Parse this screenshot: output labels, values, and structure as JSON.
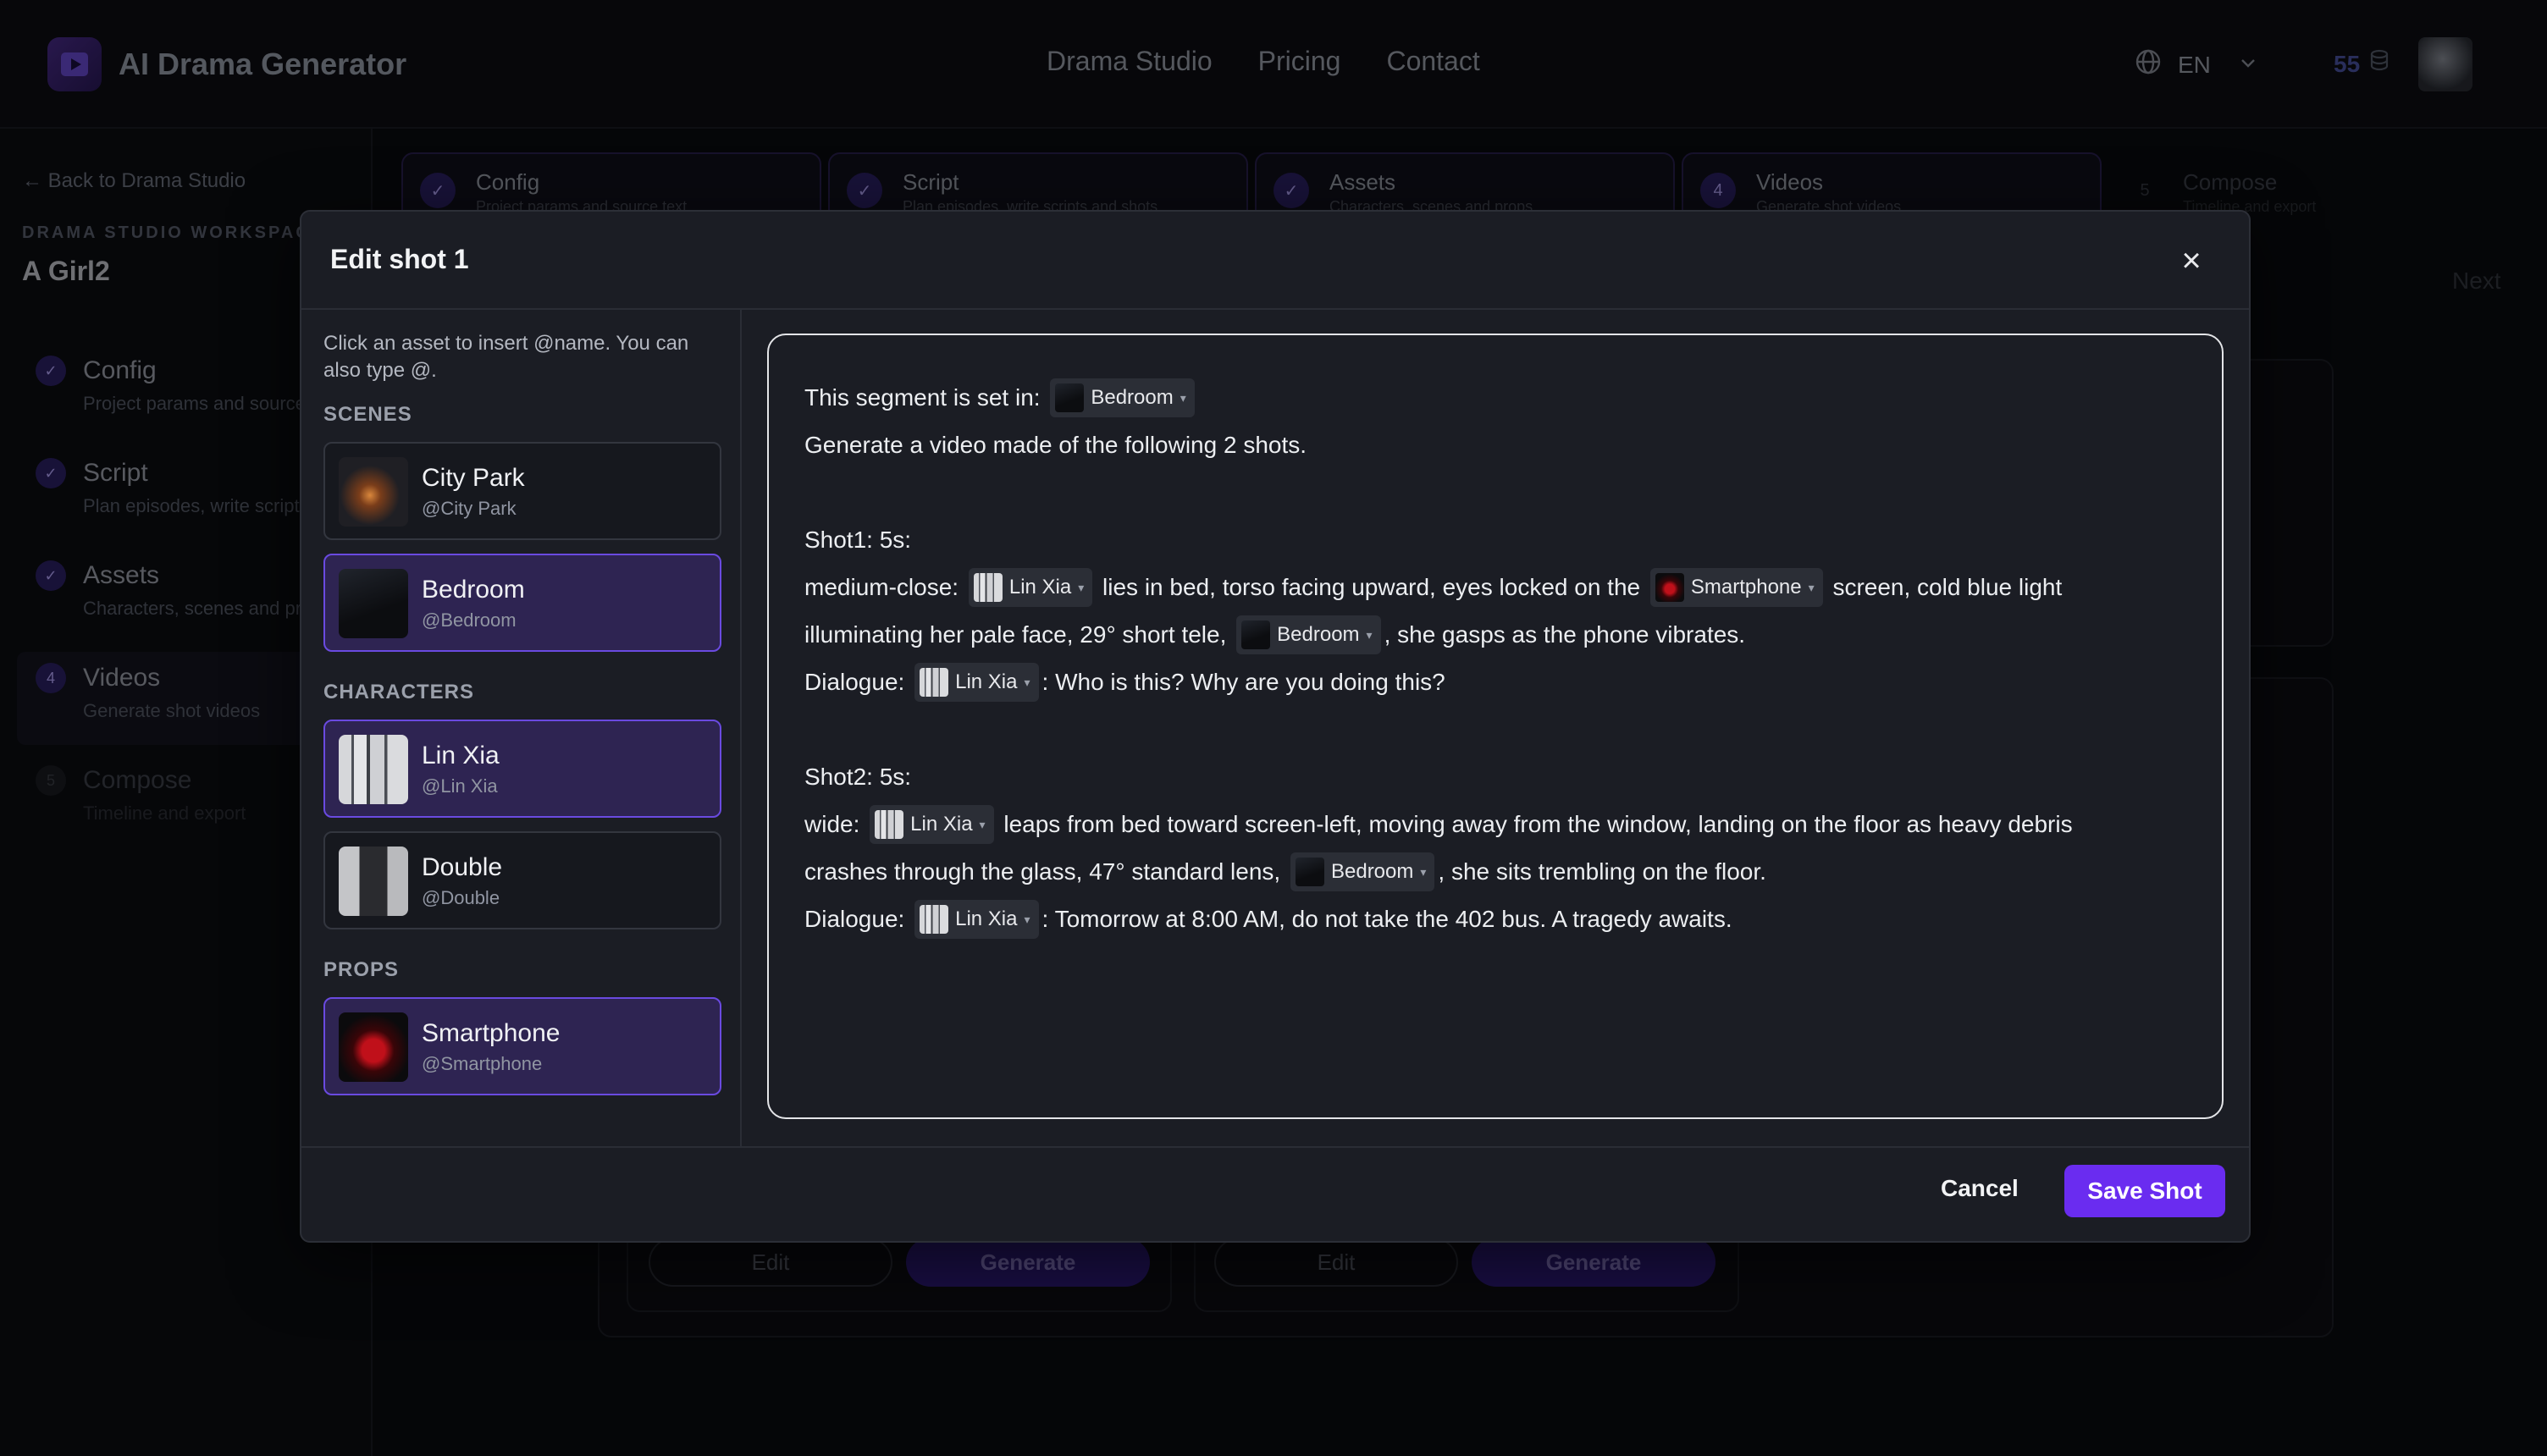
{
  "header": {
    "app_title": "AI Drama Generator",
    "nav": [
      "Drama Studio",
      "Pricing",
      "Contact"
    ],
    "language": "EN",
    "credits": "55"
  },
  "sidebar": {
    "back_link": "← Back to Drama Studio",
    "workspace_label": "DRAMA STUDIO WORKSPACE",
    "project_title": "A Girl2",
    "steps": [
      {
        "title": "Config",
        "subtitle": "Project params and source text",
        "num": "✓"
      },
      {
        "title": "Script",
        "subtitle": "Plan episodes, write scripts and shots",
        "num": "✓"
      },
      {
        "title": "Assets",
        "subtitle": "Characters, scenes and props",
        "num": "✓"
      },
      {
        "title": "Videos",
        "subtitle": "Generate shot videos",
        "num": "4"
      },
      {
        "title": "Compose",
        "subtitle": "Timeline and export",
        "num": "5"
      }
    ]
  },
  "topbar": {
    "steps": [
      {
        "title": "Config",
        "subtitle": "Project params and source text",
        "num": "✓"
      },
      {
        "title": "Script",
        "subtitle": "Plan episodes, write scripts and shots",
        "num": "✓"
      },
      {
        "title": "Assets",
        "subtitle": "Characters, scenes and props",
        "num": "✓"
      },
      {
        "title": "Videos",
        "subtitle": "Generate shot videos",
        "num": "4"
      },
      {
        "title": "Compose",
        "subtitle": "Timeline and export",
        "num": "5"
      }
    ],
    "next_label": "Next"
  },
  "background_cards": {
    "edit_label": "Edit",
    "generate_label": "Generate"
  },
  "modal": {
    "title": "Edit shot 1",
    "close_icon": "×",
    "hint": "Click an asset to insert @name. You can also type @.",
    "sections": {
      "scenes": "SCENES",
      "characters": "CHARACTERS",
      "props": "PROPS"
    },
    "assets": {
      "city_park": {
        "name": "City Park",
        "handle": "@City Park"
      },
      "bedroom": {
        "name": "Bedroom",
        "handle": "@Bedroom"
      },
      "lin_xia": {
        "name": "Lin Xia",
        "handle": "@Lin Xia"
      },
      "double": {
        "name": "Double",
        "handle": "@Double"
      },
      "smartphone": {
        "name": "Smartphone",
        "handle": "@Smartphone"
      }
    },
    "chips": {
      "bedroom": "Bedroom",
      "lin_xia": "Lin Xia",
      "smartphone": "Smartphone"
    },
    "editor": {
      "l1": "This segment is set in:",
      "l2": "Generate a video made of the following 2 shots.",
      "s1_head": "Shot1: 5s:",
      "s1_a": "medium-close:",
      "s1_b": "lies in bed, torso facing upward, eyes locked on the",
      "s1_c": "screen, cold blue light",
      "s1_d": "illuminating her pale face, 29° short tele,",
      "s1_e": ", she gasps as the phone vibrates.",
      "dialogue_label": "Dialogue:",
      "s1_dialogue": ": Who is this? Why are you doing this?",
      "s2_head": "Shot2: 5s:",
      "s2_a": "wide:",
      "s2_b": "leaps from bed toward screen-left, moving away from the window, landing on the floor as heavy debris",
      "s2_c": "crashes through the glass, 47° standard lens,",
      "s2_d": ", she sits trembling on the floor.",
      "s2_dialogue": ": Tomorrow at 8:00 AM, do not take the 402 bus. A tragedy awaits."
    },
    "cancel_label": "Cancel",
    "save_label": "Save Shot"
  }
}
